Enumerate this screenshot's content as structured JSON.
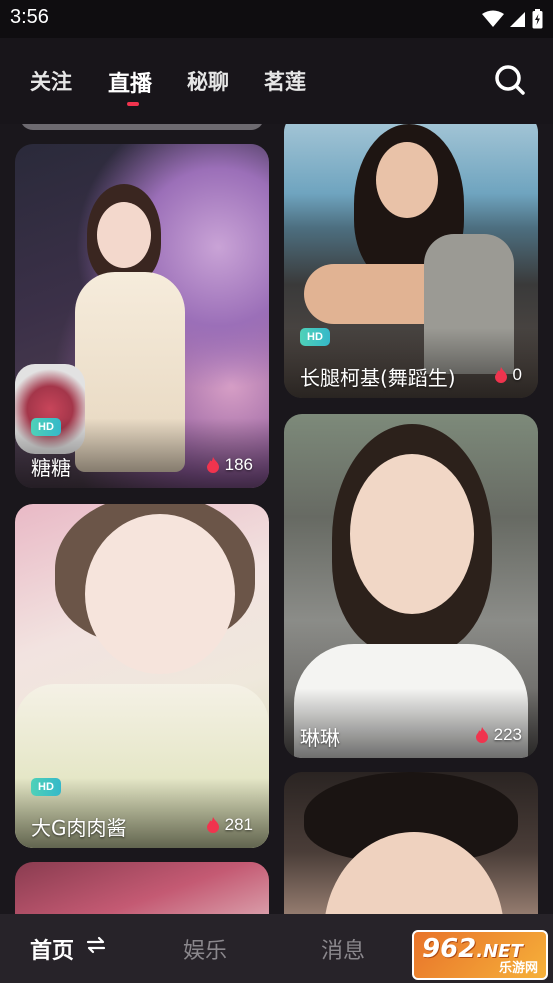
{
  "status_bar": {
    "time": "3:56"
  },
  "header": {
    "tabs": [
      {
        "label": "关注"
      },
      {
        "label": "直播"
      },
      {
        "label": "秘聊"
      },
      {
        "label": "茗莲"
      }
    ],
    "active_tab": "直播"
  },
  "feed": {
    "cards": [
      {
        "name": "糖糖",
        "count": "186",
        "hd": "HD"
      },
      {
        "name": "长腿柯基(舞蹈生)",
        "count": "0",
        "hd": "HD"
      },
      {
        "name": "大G肉肉酱",
        "count": "281",
        "hd": "HD"
      },
      {
        "name": "琳琳",
        "count": "223"
      }
    ]
  },
  "bottom_nav": {
    "items": [
      {
        "label": "首页"
      },
      {
        "label": "娱乐"
      },
      {
        "label": "消息"
      }
    ],
    "active": "首页"
  },
  "watermark": {
    "text": "962",
    "suffix": ".NET",
    "sub": "乐游网"
  },
  "colors": {
    "accent": "#f0344e",
    "hd_badge": "#3fc4c0",
    "background": "#1a171c"
  }
}
